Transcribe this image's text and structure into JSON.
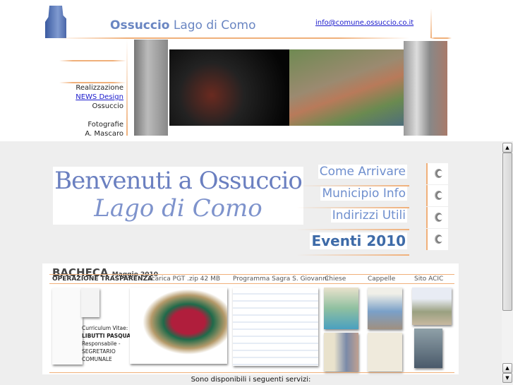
{
  "header": {
    "title_bold": "Ossuccio",
    "title_rest": " Lago di Como",
    "email": "info@comune.ossuccio.co.it"
  },
  "credits": {
    "realizzazione_label": "Realizzazione",
    "realizzazione_link": "NEWS Design",
    "realizzazione_place": "Ossuccio",
    "foto_label": "Fotografie",
    "foto_author": "A. Mascaro"
  },
  "welcome": {
    "line1": "Benvenuti a Ossuccio",
    "line2": "Lago di Como"
  },
  "menu": {
    "items": [
      "Come Arrivare",
      "Municipio Info",
      "Indirizzi Utili",
      "Eventi 2010"
    ]
  },
  "bacheca": {
    "title": "BACHECA",
    "date": "Maggio 2010",
    "sections": [
      "OPERAZIONE TRASPARENZA",
      "scarica PGT .zip 42 MB",
      "Programma Sagra S. Giovanni",
      "Chiese",
      "Cappelle",
      "Sito ACIC"
    ],
    "cv_lines": [
      "Curriculum Vitae:",
      "LIBUTTI PASQUALINA",
      "Responsabile -",
      "SEGRETARIO",
      "COMUNALE"
    ]
  },
  "footer": {
    "servizi": "Sono disponibili i seguenti servizi:"
  },
  "colors": {
    "accent_orange": "#f0b07a",
    "title_blue": "#6a86c2",
    "background": "#eeeeee"
  }
}
